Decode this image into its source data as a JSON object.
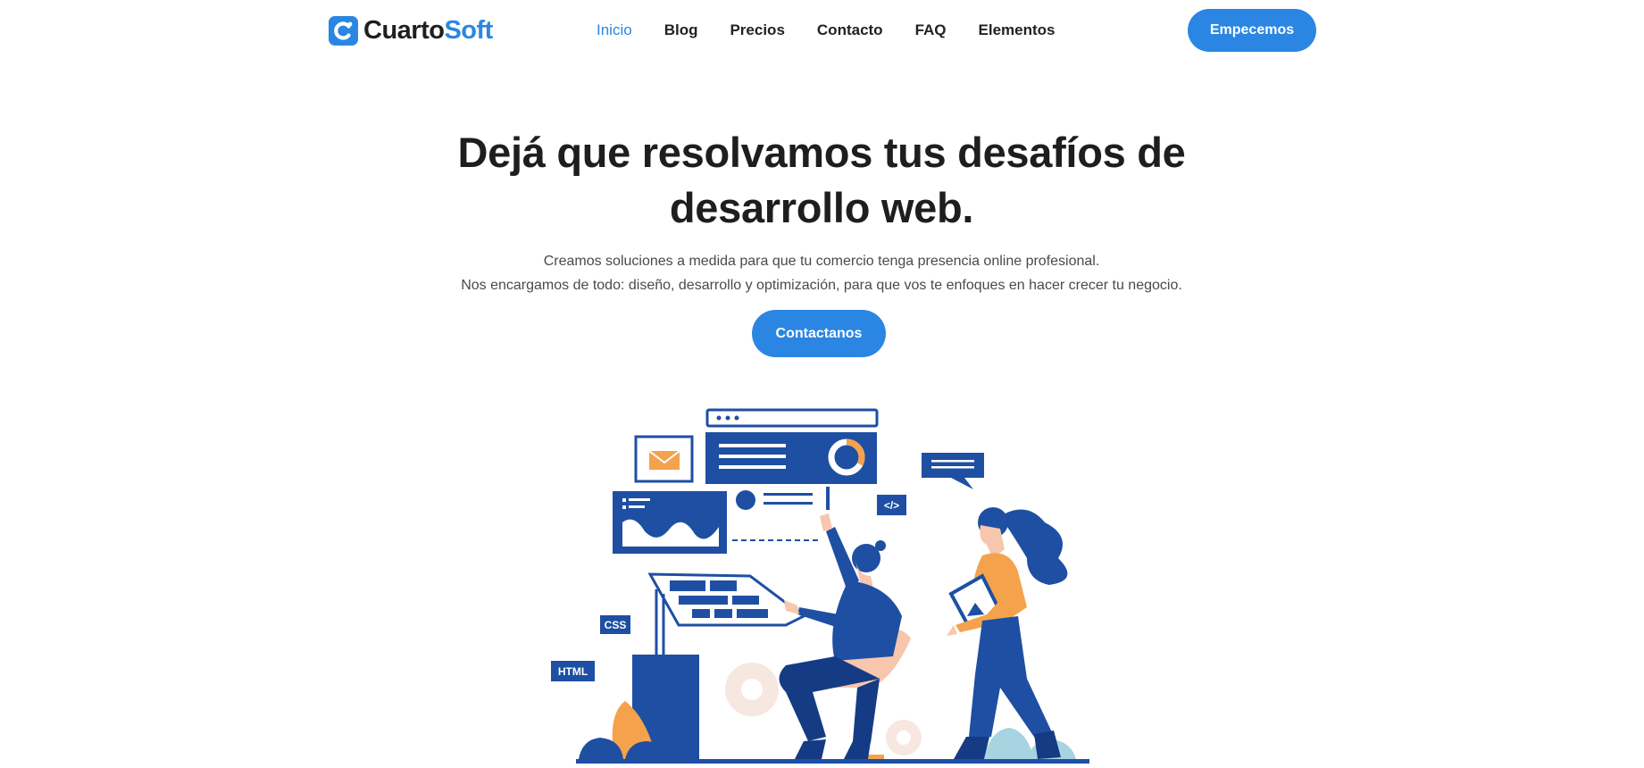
{
  "brand": {
    "name_part1": "Cuarto",
    "name_part2": "Soft",
    "logo_icon": "logo-c-mark",
    "accent_color": "#2a86e2",
    "dark_color": "#1e4fa3"
  },
  "nav": {
    "items": [
      {
        "label": "Inicio",
        "active": true
      },
      {
        "label": "Blog"
      },
      {
        "label": "Precios"
      },
      {
        "label": "Contacto"
      },
      {
        "label": "FAQ"
      },
      {
        "label": "Elementos"
      }
    ],
    "cta_label": "Empecemos"
  },
  "hero": {
    "title_line1": "Dejá que resolvamos tus desafíos de",
    "title_line2": "desarrollo web.",
    "subtitle_line1": "Creamos soluciones a medida para que tu comercio tenga presencia online profesional.",
    "subtitle_line2": "Nos encargamos de todo: diseño, desarrollo y optimización, para que vos te enfoques en hacer crecer tu negocio.",
    "cta_label": "Contactanos"
  },
  "illustration": {
    "css_tag": "CSS",
    "html_tag": "HTML",
    "code_tag": "</>"
  }
}
